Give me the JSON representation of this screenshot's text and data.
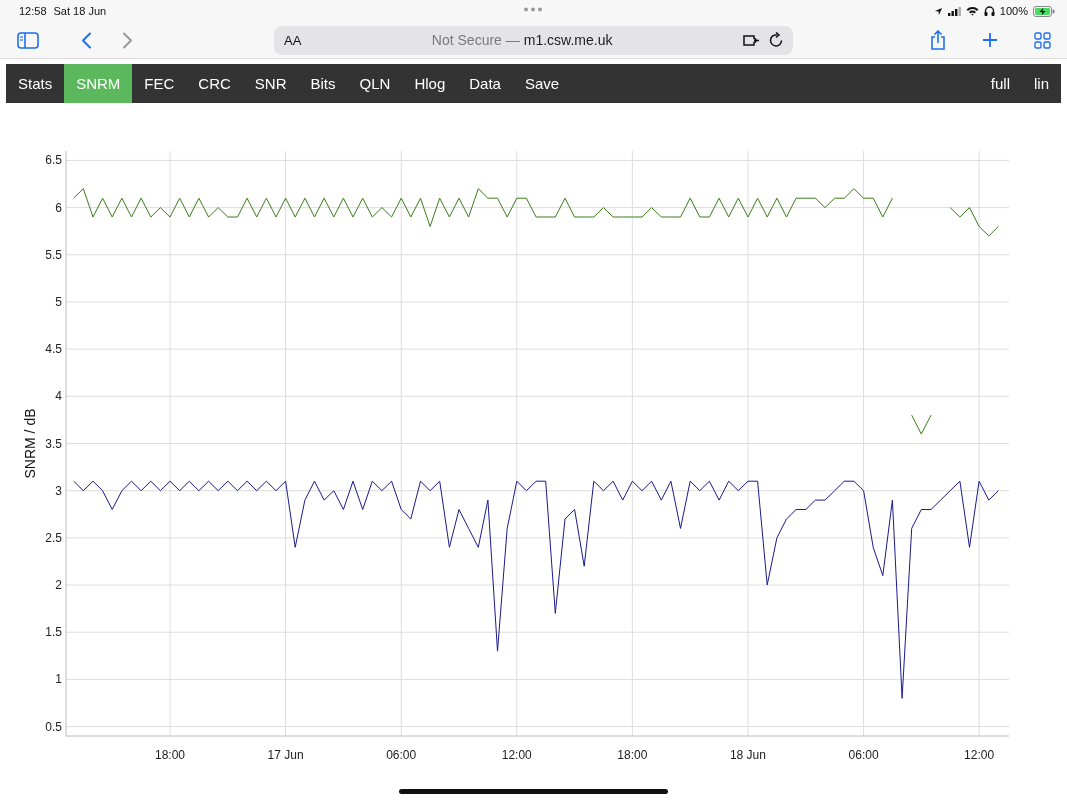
{
  "status_bar": {
    "time": "12:58",
    "date": "Sat 18 Jun",
    "battery": "100%"
  },
  "browser_toolbar": {
    "text_size_button": "AA",
    "security_label": "Not Secure —",
    "domain": "m1.csw.me.uk",
    "back_enabled": true,
    "forward_enabled": false
  },
  "nav": {
    "tabs": [
      {
        "label": "Stats",
        "selected": false
      },
      {
        "label": "SNRM",
        "selected": true
      },
      {
        "label": "FEC",
        "selected": false
      },
      {
        "label": "CRC",
        "selected": false
      },
      {
        "label": "SNR",
        "selected": false
      },
      {
        "label": "Bits",
        "selected": false
      },
      {
        "label": "QLN",
        "selected": false
      },
      {
        "label": "Hlog",
        "selected": false
      },
      {
        "label": "Data",
        "selected": false
      },
      {
        "label": "Save",
        "selected": false
      }
    ],
    "right_links": [
      "full",
      "lin"
    ]
  },
  "chart": {
    "chart_data": {
      "type": "line",
      "grid": true,
      "ylabel": "SNRM / dB",
      "categories": [
        null,
        null,
        null,
        null,
        null,
        null,
        null,
        null,
        null,
        null,
        "18:00",
        null,
        null,
        null,
        null,
        null,
        null,
        null,
        null,
        null,
        null,
        null,
        "17 Jun",
        null,
        null,
        null,
        null,
        null,
        null,
        null,
        null,
        null,
        null,
        null,
        "06:00",
        null,
        null,
        null,
        null,
        null,
        null,
        null,
        null,
        null,
        null,
        null,
        "12:00",
        null,
        null,
        null,
        null,
        null,
        null,
        null,
        null,
        null,
        null,
        null,
        "18:00",
        null,
        null,
        null,
        null,
        null,
        null,
        null,
        null,
        null,
        null,
        null,
        "18 Jun",
        null,
        null,
        null,
        null,
        null,
        null,
        null,
        null,
        null,
        null,
        null,
        "06:00",
        null,
        null,
        null,
        null,
        null,
        null,
        null,
        null,
        null,
        null,
        null,
        "12:00",
        null,
        null
      ],
      "series": [
        {
          "color": "#3a7d1a",
          "values": [
            6.1,
            6.2,
            5.9,
            6.1,
            5.9,
            6.1,
            5.9,
            6.1,
            5.9,
            6,
            5.9,
            6.1,
            5.9,
            6.1,
            5.9,
            6,
            5.9,
            5.9,
            6.1,
            5.9,
            6.1,
            5.9,
            6.1,
            5.9,
            6.1,
            5.9,
            6.1,
            5.9,
            6.1,
            5.9,
            6.1,
            5.9,
            6,
            5.9,
            6.1,
            5.9,
            6.1,
            5.8,
            6.1,
            5.9,
            6.1,
            5.9,
            6.2,
            6.1,
            6.1,
            5.9,
            6.1,
            6.1,
            5.9,
            5.9,
            5.9,
            6.1,
            5.9,
            5.9,
            5.9,
            6,
            5.9,
            5.9,
            5.9,
            5.9,
            6,
            5.9,
            5.9,
            5.9,
            6.1,
            5.9,
            5.9,
            6.1,
            5.9,
            6.1,
            5.9,
            6.1,
            5.9,
            6.1,
            5.9,
            6.1,
            6.1,
            6.1,
            6,
            6.1,
            6.1,
            6.2,
            6.1,
            6.1,
            5.9,
            6.1,
            null,
            3.8,
            3.6,
            3.8,
            null,
            6,
            5.9,
            6,
            5.8,
            5.7,
            5.8
          ]
        },
        {
          "color": "#1a1a8c",
          "values": [
            3.1,
            3,
            3.1,
            3,
            2.8,
            3,
            3.1,
            3,
            3.1,
            3,
            3.1,
            3,
            3.1,
            3,
            3.1,
            3,
            3.1,
            3,
            3.1,
            3,
            3.1,
            3,
            3.1,
            2.4,
            2.9,
            3.1,
            2.9,
            3,
            2.8,
            3.1,
            2.8,
            3.1,
            3,
            3.1,
            2.8,
            2.7,
            3.1,
            3,
            3.1,
            2.4,
            2.8,
            2.6,
            2.4,
            2.9,
            1.3,
            2.6,
            3.1,
            3,
            3.1,
            3.1,
            1.7,
            2.7,
            2.8,
            2.2,
            3.1,
            3,
            3.1,
            2.9,
            3.1,
            3,
            3.1,
            2.9,
            3.1,
            2.6,
            3.1,
            3,
            3.1,
            2.9,
            3.1,
            3,
            3.1,
            3.1,
            2,
            2.5,
            2.7,
            2.8,
            2.8,
            2.9,
            2.9,
            3,
            3.1,
            3.1,
            3,
            2.4,
            2.1,
            2.9,
            0.8,
            2.6,
            2.8,
            2.8,
            2.9,
            3,
            3.1,
            2.4,
            3.1,
            2.9,
            3
          ]
        }
      ],
      "ylim": [
        0.4,
        6.6
      ],
      "yticks": [
        0.5,
        1,
        1.5,
        2,
        2.5,
        3,
        3.5,
        4,
        4.5,
        5,
        5.5,
        6,
        6.5
      ]
    }
  }
}
